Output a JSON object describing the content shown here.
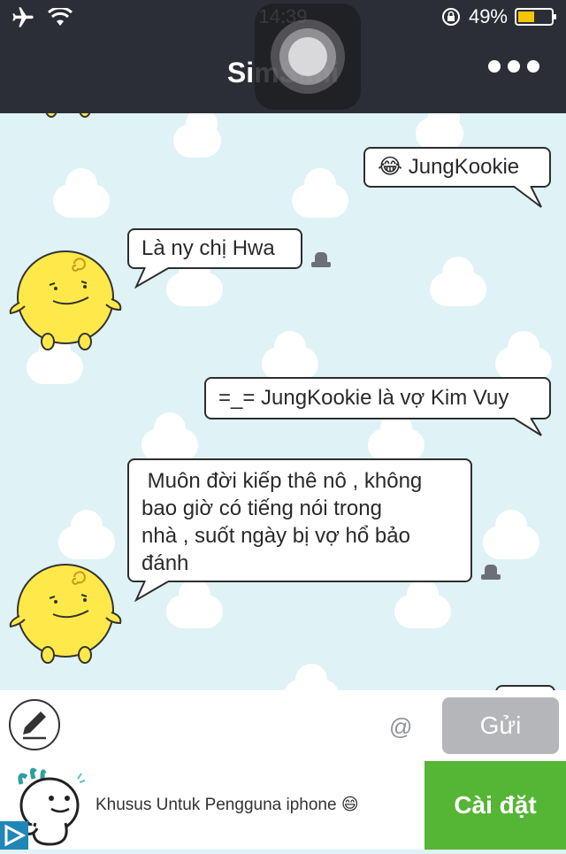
{
  "status_bar": {
    "time": "14:39",
    "battery": "49%",
    "battery_level": 0.49
  },
  "header": {
    "title": "SimSimi"
  },
  "messages": [
    {
      "sender": "user",
      "text": "JungKookie",
      "emoji": "😂"
    },
    {
      "sender": "simsimi",
      "text": "Là ny chị Hwa"
    },
    {
      "sender": "user",
      "text": "=_= JungKookie là vợ Kim Vuy"
    },
    {
      "sender": "simsimi",
      "lines": [
        " Muôn đời kiếp thê nô , không",
        "bao giờ có tiếng nói trong",
        "nhà , suốt ngày bị vợ hổ bảo",
        "đánh"
      ]
    }
  ],
  "input_bar": {
    "at_symbol": "@",
    "send_label": "Gửi"
  },
  "ad": {
    "text": "Khusus Untuk Pengguna iphone 😄",
    "install_label": "Cài đặt"
  },
  "colors": {
    "header_bg": "#2b2e36",
    "chat_bg": "#dff2f5",
    "install_green": "#55b534",
    "send_gray": "#b4b6b9",
    "simsimi_yellow": "#ffe94a"
  }
}
